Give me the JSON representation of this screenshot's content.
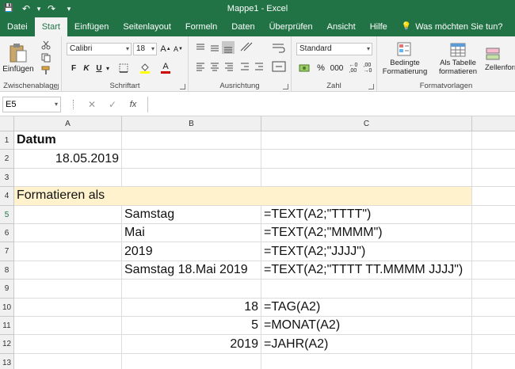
{
  "window": {
    "title": "Mappe1  -  Excel"
  },
  "qat": {
    "save": "💾",
    "undo": "↶",
    "undo_dd": "▾",
    "redo": "↷",
    "customize": "▾"
  },
  "tabs": [
    "Datei",
    "Start",
    "Einfügen",
    "Seitenlayout",
    "Formeln",
    "Daten",
    "Überprüfen",
    "Ansicht",
    "Hilfe"
  ],
  "search": {
    "icon": "💡",
    "label": "Was möchten Sie tun?"
  },
  "ribbon": {
    "clipboard": {
      "paste_label": "Einfügen",
      "group_label": "Zwischenablage"
    },
    "font": {
      "name": "Calibri",
      "size": "18",
      "bold": "F",
      "italic": "K",
      "underline": "U",
      "group_label": "Schriftart"
    },
    "alignment": {
      "group_label": "Ausrichtung"
    },
    "number": {
      "format": "Standard",
      "percent": "%",
      "thousands": "000",
      "group_label": "Zahl"
    },
    "styles": {
      "conditional_line1": "Bedingte",
      "conditional_line2": "Formatierung",
      "table_line1": "Als Tabelle",
      "table_line2": "formatieren",
      "cellstyles": "Zellenform",
      "group_label": "Formatvorlagen"
    }
  },
  "formula_bar": {
    "name_box": "E5",
    "cancel": "✕",
    "enter": "✓",
    "fx": "fx",
    "value": ""
  },
  "columns": [
    "A",
    "B",
    "C"
  ],
  "rows": [
    {
      "n": "1",
      "a": "Datum",
      "b": "",
      "c": ""
    },
    {
      "n": "2",
      "a": "18.05.2019",
      "b": "",
      "c": ""
    },
    {
      "n": "3",
      "a": "",
      "b": "",
      "c": ""
    },
    {
      "n": "4",
      "a": "Formatieren als",
      "b": "",
      "c": ""
    },
    {
      "n": "5",
      "a": "",
      "b": "Samstag",
      "c": "=TEXT(A2;\"TTTT\")"
    },
    {
      "n": "6",
      "a": "",
      "b": "Mai",
      "c": "=TEXT(A2;\"MMMM\")"
    },
    {
      "n": "7",
      "a": "",
      "b": "2019",
      "c": "=TEXT(A2;\"JJJJ\")"
    },
    {
      "n": "8",
      "a": "",
      "b": "Samstag 18.Mai 2019",
      "c": "=TEXT(A2;\"TTTT TT.MMMM JJJJ\")"
    },
    {
      "n": "9",
      "a": "",
      "b": "",
      "c": ""
    },
    {
      "n": "10",
      "a": "",
      "b": "18",
      "c": "=TAG(A2)"
    },
    {
      "n": "11",
      "a": "",
      "b": "5",
      "c": "=MONAT(A2)"
    },
    {
      "n": "12",
      "a": "",
      "b": "2019",
      "c": "=JAHR(A2)"
    },
    {
      "n": "13",
      "a": "",
      "b": "",
      "c": ""
    }
  ],
  "colors": {
    "accent": "#217346",
    "highlight_band": "#fff2cc"
  }
}
